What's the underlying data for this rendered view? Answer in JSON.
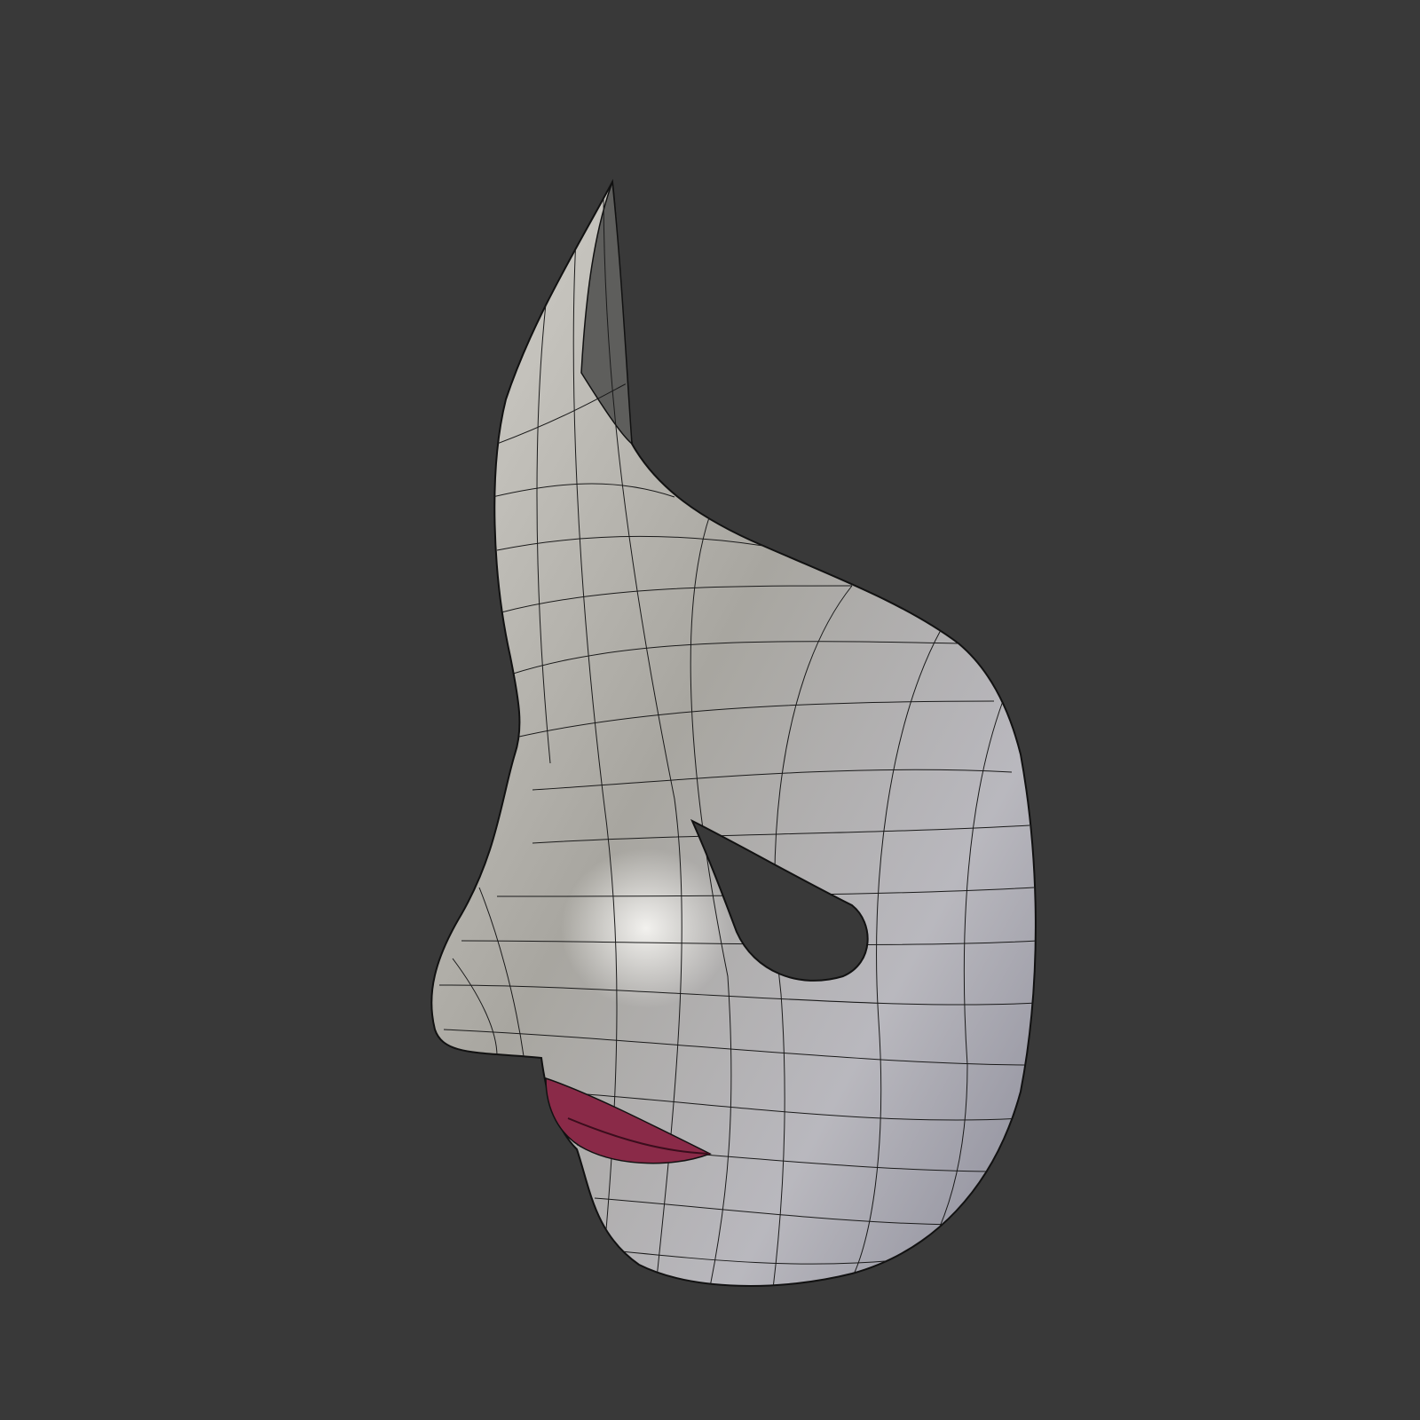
{
  "scene": {
    "subject": "mask-model",
    "colors": {
      "background": "#393939",
      "surface_light": "#d8d6d2",
      "surface_mid": "#a9a7a3",
      "surface_shadow": "#7c7b80",
      "inner_surface": "#5e5e5c",
      "lips": "#8a2a48",
      "wire": "#1a1a1a"
    }
  }
}
